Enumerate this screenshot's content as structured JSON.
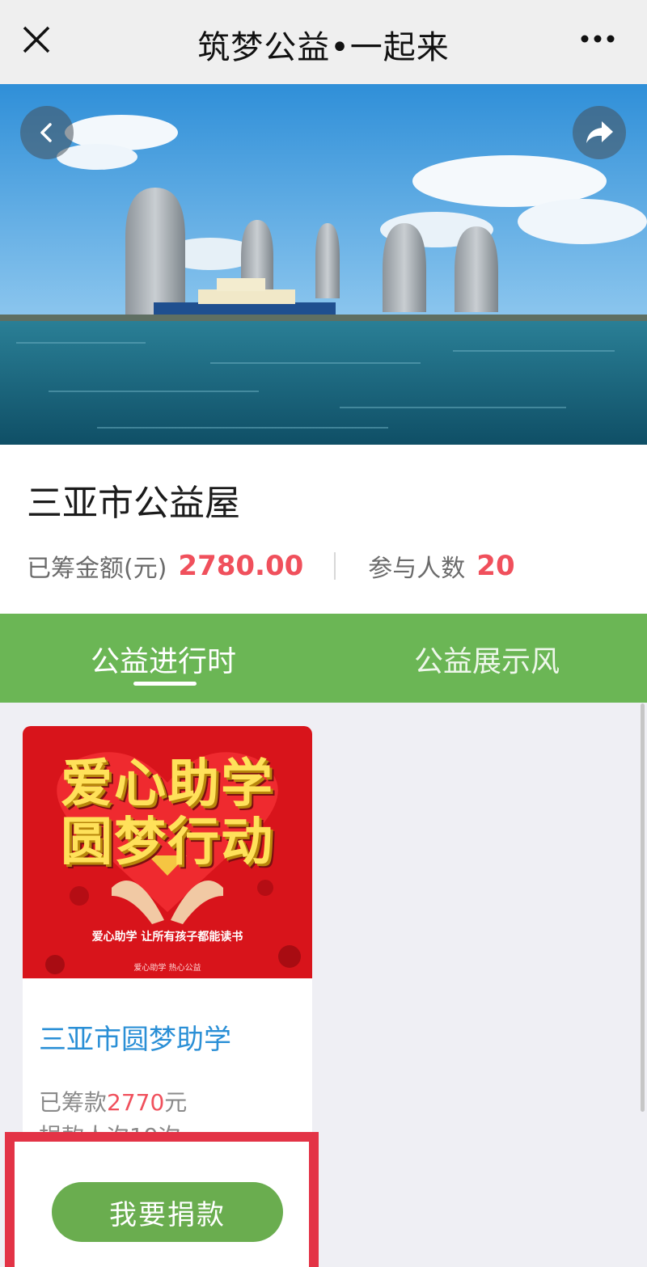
{
  "topbar": {
    "title": "筑梦公益•一起来",
    "close_icon": "close-icon",
    "more_icon": "more-icon"
  },
  "hero": {
    "back_icon": "back-arrow-icon",
    "share_icon": "share-arrow-icon"
  },
  "info": {
    "name": "三亚市公益屋",
    "raised_label": "已筹金额(元)",
    "raised_value": "2780.00",
    "participants_label": "参与人数",
    "participants_value": "20"
  },
  "tabs": [
    {
      "label": "公益进行时",
      "active": true
    },
    {
      "label": "公益展示风",
      "active": false
    }
  ],
  "card": {
    "poster_line1": "爱心助学",
    "poster_line2": "圆梦行动",
    "poster_slogan": "爱心助学 让所有孩子都能读书",
    "poster_tag": "爱心助学 热心公益",
    "title": "三亚市圆梦助学",
    "raised_prefix": "已筹款",
    "raised_amount": "2770",
    "raised_suffix": "元",
    "donors": "捐款人次19次"
  },
  "donate_button": "我要捐款",
  "colors": {
    "accent_green": "#6bb655",
    "highlight_red": "#f0505c",
    "link_blue": "#2a8fd6",
    "annotation_red": "#e33346"
  }
}
